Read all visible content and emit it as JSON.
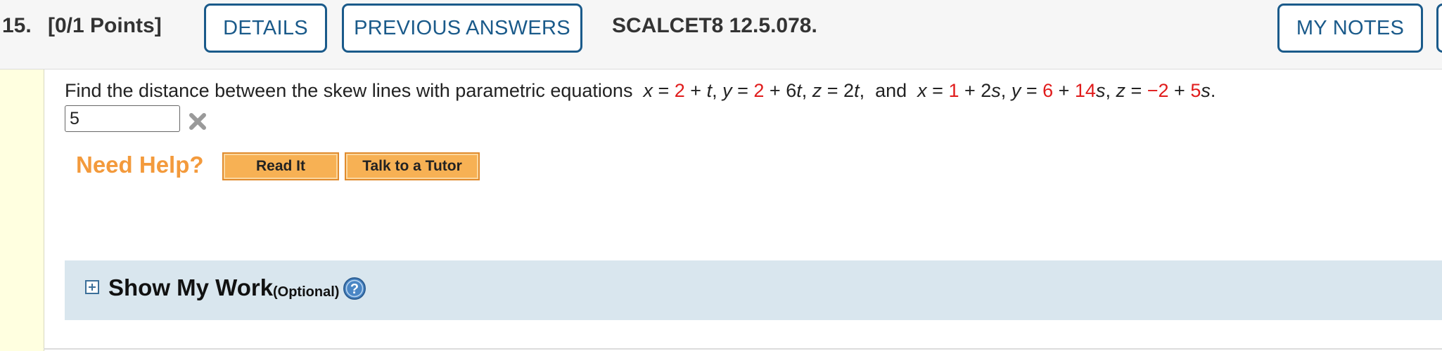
{
  "header": {
    "question_number": "15.",
    "points": "[0/1 Points]",
    "details_label": "DETAILS",
    "previous_answers_label": "PREVIOUS ANSWERS",
    "question_id": "SCALCET8 12.5.078.",
    "my_notes_label": "MY NOTES"
  },
  "question": {
    "prompt": "Find the distance between the skew lines with parametric equations",
    "line1": {
      "x_var": "x",
      "eq": " = ",
      "x_const": "2",
      "plus": " + ",
      "x_param": "t",
      "y_var": "y",
      "y_const": "2",
      "y_coef": "6",
      "y_param": "t",
      "z_var": "z",
      "z_coef": "2",
      "z_param": "t"
    },
    "and_text": "and",
    "line2": {
      "x_var": "x",
      "x_const": "1",
      "x_coef": "2",
      "x_param": "s",
      "y_var": "y",
      "y_const": "6",
      "y_coef": "14",
      "y_param": "s",
      "z_var": "z",
      "z_const": "−2",
      "z_coef": "5",
      "z_param": "s"
    }
  },
  "answer": {
    "value": "5",
    "status": "incorrect"
  },
  "help": {
    "label": "Need Help?",
    "read_it_label": "Read It",
    "tutor_label": "Talk to a Tutor"
  },
  "show_work": {
    "title": "Show My Work",
    "optional_label": "(Optional)"
  },
  "colors": {
    "accent": "#1a5a8a",
    "red_values": "#e01b1b",
    "help_orange": "#f39a3c",
    "work_bar": "#d9e6ee"
  },
  "icons": {
    "wrong": "x-icon",
    "expand": "plus-box-icon",
    "help": "question-circle-icon"
  }
}
